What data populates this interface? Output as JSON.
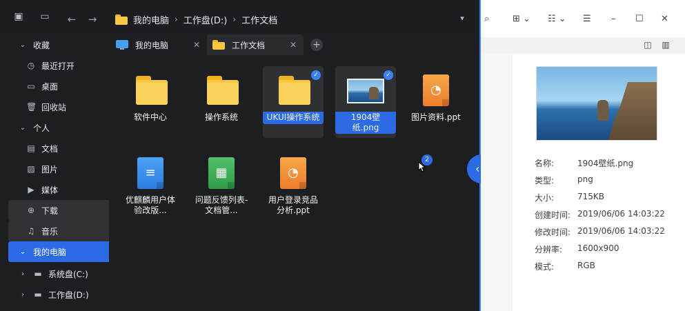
{
  "breadcrumb": {
    "items": [
      "我的电脑",
      "工作盘(D:)",
      "工作文档"
    ]
  },
  "sidebar": {
    "items": [
      {
        "label": "收藏"
      },
      {
        "label": "最近打开"
      },
      {
        "label": "桌面"
      },
      {
        "label": "回收站"
      },
      {
        "label": "个人"
      },
      {
        "label": "文档"
      },
      {
        "label": "图片"
      },
      {
        "label": "媒体"
      },
      {
        "label": "下载"
      },
      {
        "label": "音乐"
      },
      {
        "label": "我的电脑"
      },
      {
        "label": "系统盘(C:)"
      },
      {
        "label": "工作盘(D:)"
      }
    ]
  },
  "tabs": [
    {
      "label": "我的电脑"
    },
    {
      "label": "工作文档"
    }
  ],
  "files": [
    {
      "label": "软件中心"
    },
    {
      "label": "操作系统"
    },
    {
      "label": "UKUI操作系统"
    },
    {
      "label": "1904壁纸.png"
    },
    {
      "label": "图片资料.ppt"
    },
    {
      "label": "优麒麟用户体验改版..."
    },
    {
      "label": "问题反馈列表-文档管..."
    },
    {
      "label": "用户登录竞品分析.ppt"
    }
  ],
  "selection": {
    "badge_count": "2"
  },
  "details": {
    "name_label": "名称:",
    "name_value": "1904壁纸.png",
    "type_label": "类型:",
    "type_value": "png",
    "size_label": "大小:",
    "size_value": "715KB",
    "created_label": "创建时间:",
    "created_value": "2019/06/06 14:03:22",
    "modified_label": "修改时间:",
    "modified_value": "2019/06/06 14:03:22",
    "resolution_label": "分辨率:",
    "resolution_value": "1600x900",
    "mode_label": "模式:",
    "mode_value": "RGB"
  },
  "colors": {
    "accent": "#2d6be5",
    "dark_bg": "#1d1e21",
    "folder": "#f7c642"
  }
}
